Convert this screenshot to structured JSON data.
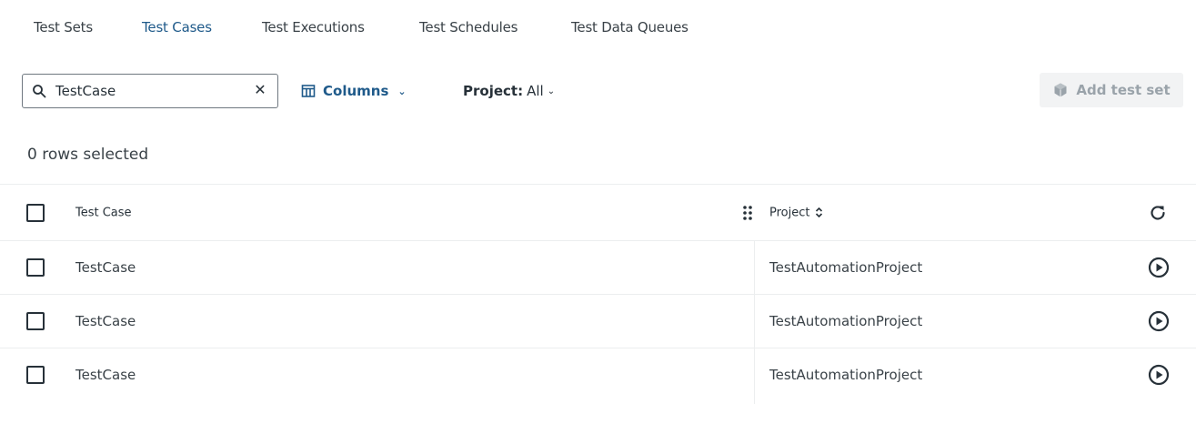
{
  "tabs": [
    {
      "label": "Test Sets",
      "active": false
    },
    {
      "label": "Test Cases",
      "active": true
    },
    {
      "label": "Test Executions",
      "active": false
    },
    {
      "label": "Test Schedules",
      "active": false
    },
    {
      "label": "Test Data Queues",
      "active": false
    }
  ],
  "toolbar": {
    "search_value": "TestCase",
    "search_icon": "search-icon",
    "clear_icon": "close-icon",
    "columns_label": "Columns",
    "project_label": "Project:",
    "project_value": "All",
    "add_label": "Add test set",
    "add_icon": "cube-icon",
    "add_disabled": true
  },
  "selection": {
    "text": "0 rows selected"
  },
  "table": {
    "headers": {
      "name": "Test Case",
      "project": "Project"
    },
    "rows": [
      {
        "name": "TestCase",
        "project": "TestAutomationProject"
      },
      {
        "name": "TestCase",
        "project": "TestAutomationProject"
      },
      {
        "name": "TestCase",
        "project": "TestAutomationProject"
      }
    ]
  },
  "colors": {
    "accent": "#1f5a8a",
    "text": "#273139",
    "disabled_bg": "#f2f3f4",
    "disabled_text": "#9aa3aa",
    "border": "#eceeef"
  }
}
